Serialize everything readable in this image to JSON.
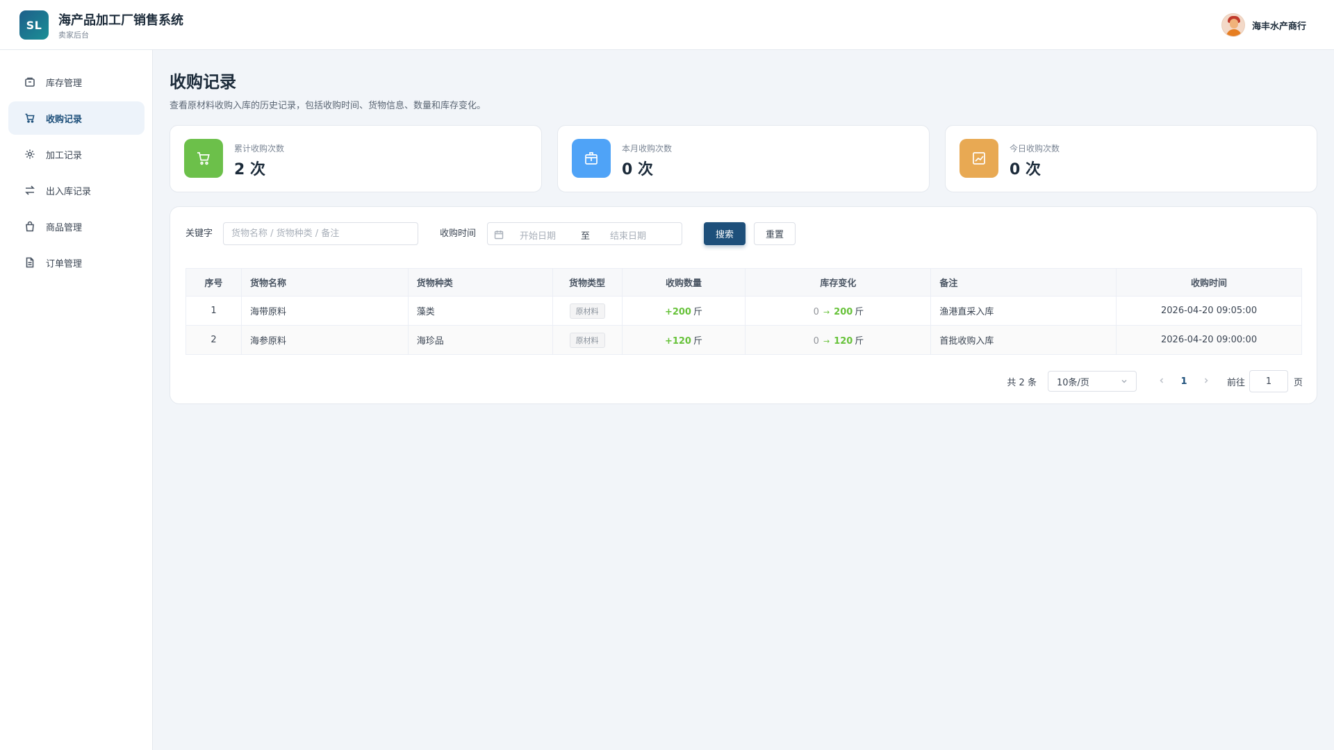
{
  "brand": {
    "logo_text": "SL",
    "title": "海产品加工厂销售系统",
    "subtitle": "卖家后台"
  },
  "user": {
    "name": "海丰水产商行"
  },
  "sidebar": {
    "items": [
      {
        "label": "库存管理",
        "icon": "inventory-icon",
        "active": false
      },
      {
        "label": "收购记录",
        "icon": "cart-icon",
        "active": true
      },
      {
        "label": "加工记录",
        "icon": "gear-icon",
        "active": false
      },
      {
        "label": "出入库记录",
        "icon": "swap-icon",
        "active": false
      },
      {
        "label": "商品管理",
        "icon": "bag-icon",
        "active": false
      },
      {
        "label": "订单管理",
        "icon": "document-icon",
        "active": false
      }
    ]
  },
  "page": {
    "title": "收购记录",
    "description": "查看原材料收购入库的历史记录，包括收购时间、货物信息、数量和库存变化。"
  },
  "stats": [
    {
      "label": "累计收购次数",
      "value": "2 次",
      "icon": "cart-icon",
      "color": "#6cc04a"
    },
    {
      "label": "本月收购次数",
      "value": "0 次",
      "icon": "box-icon",
      "color": "#4fa3f7"
    },
    {
      "label": "今日收购次数",
      "value": "0 次",
      "icon": "chart-icon",
      "color": "#e8a953"
    }
  ],
  "filters": {
    "keyword_label": "关键字",
    "keyword_placeholder": "货物名称 / 货物种类 / 备注",
    "time_label": "收购时间",
    "start_placeholder": "开始日期",
    "range_separator": "至",
    "end_placeholder": "结束日期",
    "search_label": "搜索",
    "reset_label": "重置"
  },
  "table": {
    "columns": [
      "序号",
      "货物名称",
      "货物种类",
      "货物类型",
      "收购数量",
      "库存变化",
      "备注",
      "收购时间"
    ],
    "rows": [
      {
        "index": "1",
        "name": "海带原料",
        "category": "藻类",
        "type": "原材料",
        "qty": "+200",
        "qty_unit": "斤",
        "stock_from": "0",
        "stock_to": "200",
        "stock_unit": "斤",
        "note": "渔港直采入库",
        "time": "2026-04-20 09:05:00"
      },
      {
        "index": "2",
        "name": "海参原料",
        "category": "海珍品",
        "type": "原材料",
        "qty": "+120",
        "qty_unit": "斤",
        "stock_from": "0",
        "stock_to": "120",
        "stock_unit": "斤",
        "note": "首批收购入库",
        "time": "2026-04-20 09:00:00"
      }
    ]
  },
  "pagination": {
    "total": "共 2 条",
    "page_size": "10条/页",
    "current": "1",
    "goto_label": "前往",
    "goto_value": "1",
    "page_unit": "页"
  },
  "colors": {
    "primary": "#1d4f7a",
    "success": "#67c23a"
  }
}
